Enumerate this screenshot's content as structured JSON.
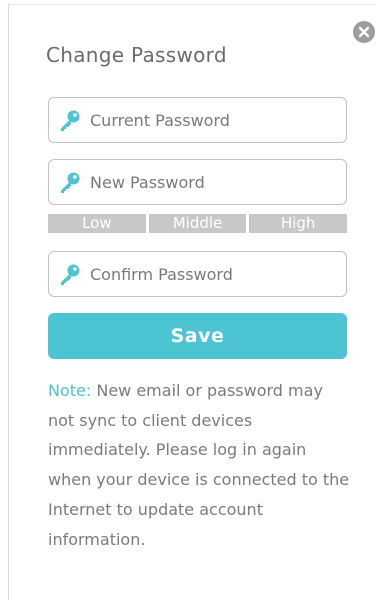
{
  "dialog": {
    "title": "Change Password",
    "close_icon": "close-icon"
  },
  "fields": {
    "current": {
      "placeholder": "Current Password",
      "value": "",
      "icon": "key-icon"
    },
    "new": {
      "placeholder": "New Password",
      "value": "",
      "icon": "key-icon"
    },
    "confirm": {
      "placeholder": "Confirm Password",
      "value": "",
      "icon": "key-icon"
    }
  },
  "strength": {
    "labels": [
      "Low",
      "Middle",
      "High"
    ]
  },
  "save_label": "Save",
  "note": {
    "label": "Note:",
    "text": " New email or password may not sync to client devices immediately. Please log in again when your device is connected to the Internet to update account information."
  },
  "colors": {
    "accent": "#4dc4d2",
    "close_bg": "#9d9d9d",
    "strength_bg": "#c8c8c8",
    "text": "#7b7b7b",
    "border": "#c3c3c3"
  }
}
